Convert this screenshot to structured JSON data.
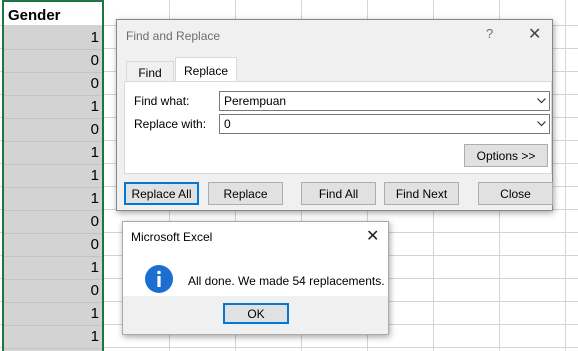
{
  "sheet": {
    "header": "Gender",
    "values": [
      "1",
      "0",
      "0",
      "1",
      "0",
      "1",
      "1",
      "1",
      "0",
      "0",
      "1",
      "0",
      "1",
      "1"
    ]
  },
  "find_replace": {
    "title": "Find and Replace",
    "help": "?",
    "close": "✕",
    "tabs": {
      "find": "Find",
      "replace": "Replace"
    },
    "find_label": "Find what:",
    "find_value": "Perempuan",
    "replace_label": "Replace with:",
    "replace_value": "0",
    "options_label": "Options >>",
    "buttons": {
      "replace_all": "Replace All",
      "replace": "Replace",
      "find_all": "Find All",
      "find_next": "Find Next",
      "close": "Close"
    }
  },
  "message_box": {
    "title": "Microsoft Excel",
    "close": "✕",
    "text": "All done. We made 54 replacements.",
    "ok_label": "OK",
    "icon": "info-icon",
    "icon_color": "#1c6fd1"
  },
  "colors": {
    "selection_border": "#217346",
    "focus_border": "#0078d7"
  }
}
